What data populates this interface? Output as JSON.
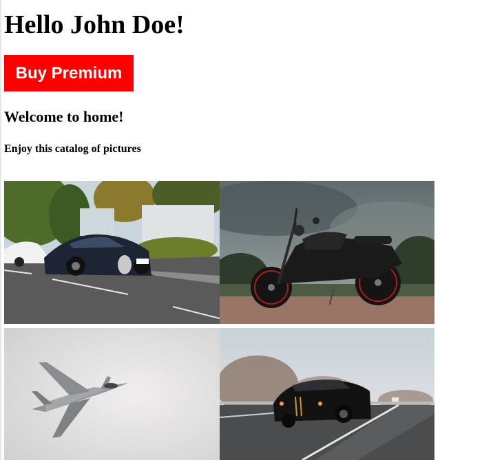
{
  "header": {
    "greeting": "Hello John Doe!"
  },
  "premium_button": {
    "label": "Buy Premium",
    "color": "#ff0000"
  },
  "welcome": {
    "title": "Welcome to home!",
    "subtitle": "Enjoy this catalog of pictures"
  },
  "gallery": {
    "images": [
      {
        "subject": "black supercar on city street"
      },
      {
        "subject": "black motorcycle under cloudy sky"
      },
      {
        "subject": "fighter jet in grey sky"
      },
      {
        "subject": "black muscle car on highway"
      }
    ]
  }
}
